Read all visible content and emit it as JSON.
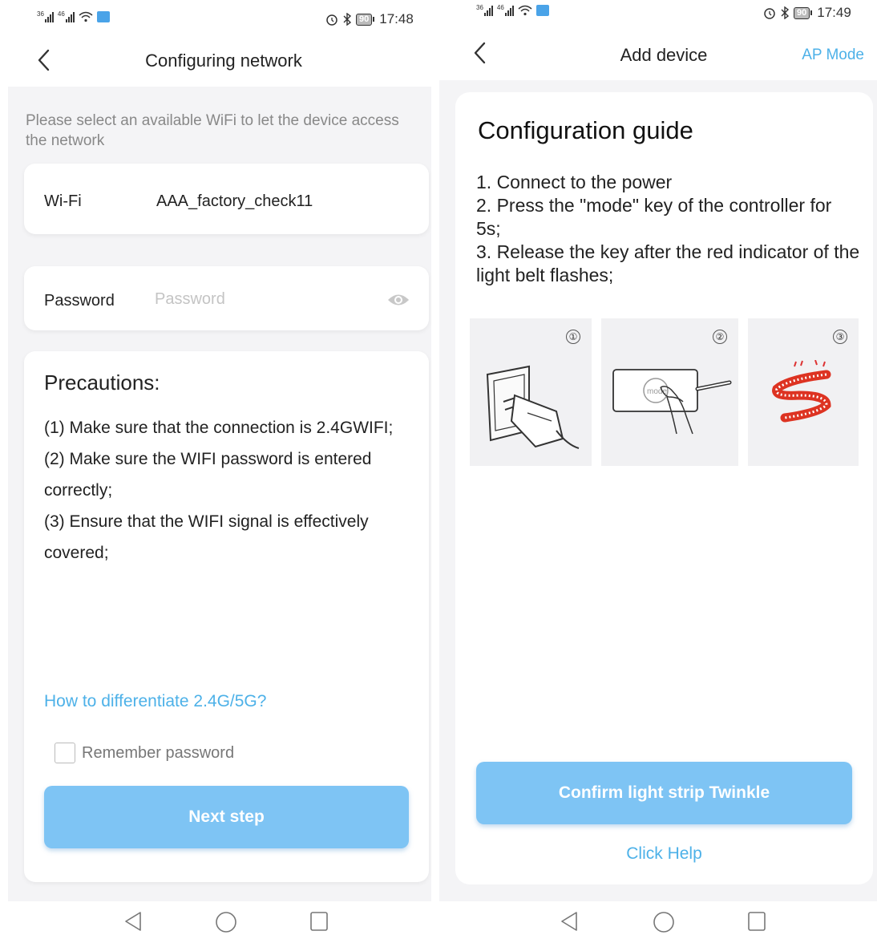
{
  "left": {
    "status": {
      "sig1": "3G",
      "sig2": "4G",
      "battery": "90",
      "time": "17:48"
    },
    "nav": {
      "title": "Configuring network"
    },
    "hint": "Please select an available WiFi to let the device access the network",
    "wifi": {
      "label": "Wi-Fi",
      "value": "AAA_factory_check11"
    },
    "password": {
      "label": "Password",
      "placeholder": "Password"
    },
    "precautions": {
      "title": "Precautions:",
      "items": [
        "(1) Make sure that the connection is 2.4GWIFI;",
        "(2) Make sure the WIFI password is entered correctly;",
        "(3) Ensure that the WIFI signal is effectively covered;"
      ]
    },
    "help_link": "How to differentiate 2.4G/5G?",
    "remember_label": "Remember password",
    "next_button": "Next step"
  },
  "right": {
    "status": {
      "sig1": "3G",
      "sig2": "4G",
      "battery": "90",
      "time": "17:49"
    },
    "nav": {
      "title": "Add device",
      "action": "AP Mode"
    },
    "guide": {
      "title": "Configuration guide",
      "steps": "1. Connect to the power\n2. Press the \"mode\" key of the controller for 5s;\n3. Release the key after the red indicator of the light belt flashes;",
      "tiles": [
        "①",
        "②",
        "③"
      ],
      "mode_key_text": "mode"
    },
    "confirm_button": "Confirm light strip Twinkle",
    "help_link": "Click Help"
  },
  "colors": {
    "accent": "#4db1e8",
    "button": "#7ec4f4",
    "background": "#f4f4f6"
  }
}
